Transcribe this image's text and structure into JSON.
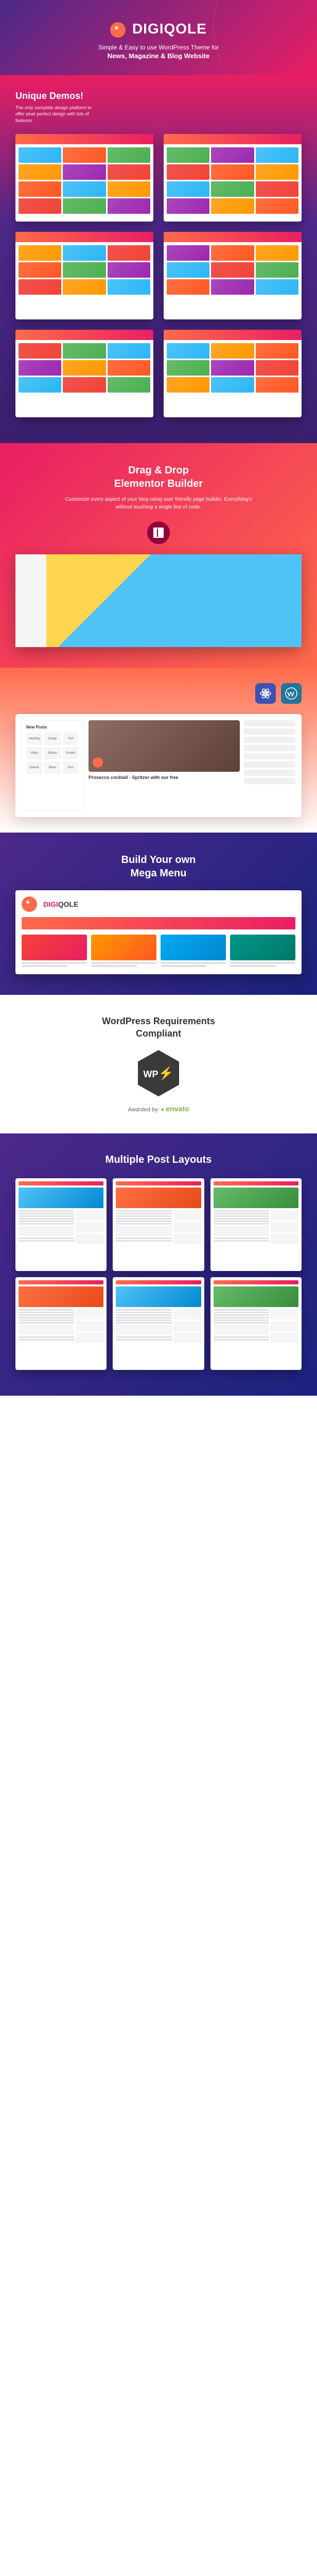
{
  "hero": {
    "brand": "DIGIQOLE",
    "tagline": "Simple & Easy to use WordPress Theme for",
    "target": "News, Magazine & Blog Website"
  },
  "demos": {
    "title": "Unique Demos!",
    "description": "The only complete design platform to offer pixel perfect design with lots of features"
  },
  "elementor": {
    "title_line1": "Drag & Drop",
    "title_line2": "Elementor Builder",
    "description": "Customize every aspect of your blog using user friendly page builder. Everything's without touching a single line of code."
  },
  "newposts": {
    "panel_title": "New Posts",
    "panel_items": [
      "Heading",
      "Image",
      "Text",
      "Video",
      "Button",
      "Divider",
      "Spacer",
      "Maps",
      "Icon"
    ],
    "article_title": "Prosecco cocktail - Spritzer with our free"
  },
  "megamenu": {
    "title_line1": "Build Your own",
    "title_line2": "Mega Menu",
    "brand_part1": "DIGI",
    "brand_part2": "QOLE"
  },
  "wpreq": {
    "title_line1": "WordPress Requirements",
    "title_line2": "Compliant",
    "badge_text": "WP",
    "awarded_label": "Awarded by:",
    "awarded_brand": "envato"
  },
  "layouts": {
    "title": "Multiple Post Layouts"
  }
}
